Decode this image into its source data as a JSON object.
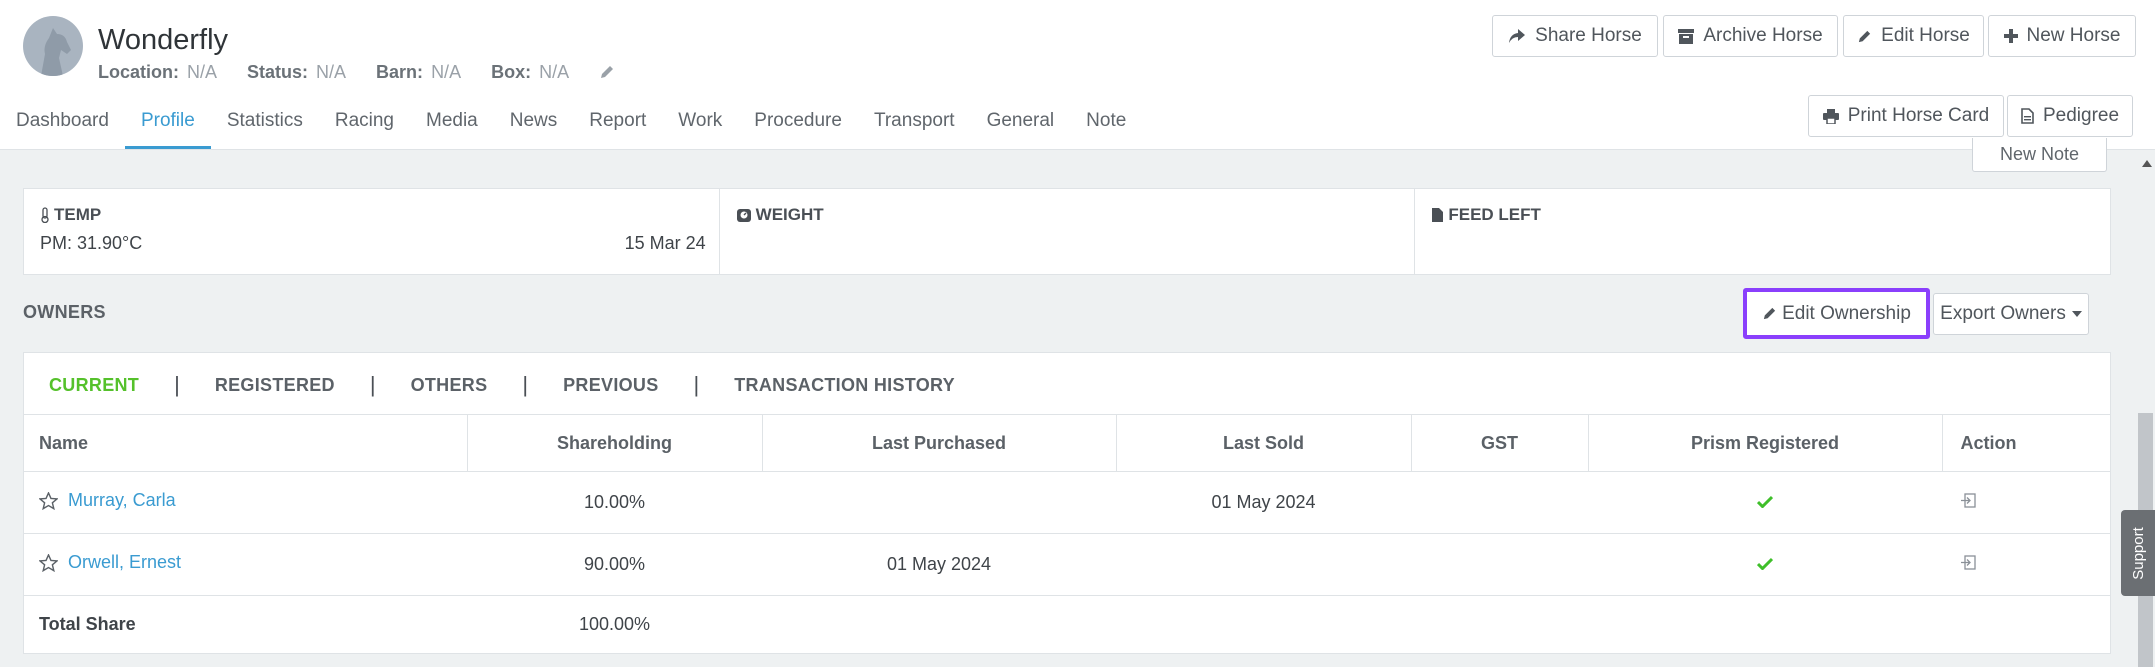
{
  "horse": {
    "name": "Wonderfly",
    "location_label": "Location:",
    "location_value": "N/A",
    "status_label": "Status:",
    "status_value": "N/A",
    "barn_label": "Barn:",
    "barn_value": "N/A",
    "box_label": "Box:",
    "box_value": "N/A"
  },
  "actions": {
    "share": "Share Horse",
    "archive": "Archive Horse",
    "edit": "Edit Horse",
    "new": "New Horse",
    "print": "Print Horse Card",
    "pedigree": "Pedigree"
  },
  "tabs": [
    "Dashboard",
    "Profile",
    "Statistics",
    "Racing",
    "Media",
    "News",
    "Report",
    "Work",
    "Procedure",
    "Transport",
    "General",
    "Note"
  ],
  "active_tab": "Profile",
  "new_note": "New Note",
  "stats": {
    "temp_label": "TEMP",
    "temp_value": "PM: 31.90°C",
    "temp_date": "15 Mar 24",
    "weight_label": "WEIGHT",
    "feed_label": "FEED LEFT"
  },
  "owners": {
    "title": "OWNERS",
    "edit_button": "Edit Ownership",
    "export_button": "Export Owners",
    "subtabs": [
      "CURRENT",
      "REGISTERED",
      "OTHERS",
      "PREVIOUS",
      "TRANSACTION HISTORY"
    ],
    "sep": "|",
    "columns": [
      "Name",
      "Shareholding",
      "Last Purchased",
      "Last Sold",
      "GST",
      "Prism Registered",
      "Action"
    ],
    "rows": [
      {
        "name": "Murray, Carla",
        "shareholding": "10.00%",
        "last_purchased": "",
        "last_sold": "01 May 2024",
        "gst": ""
      },
      {
        "name": "Orwell, Ernest",
        "shareholding": "90.00%",
        "last_purchased": "01 May 2024",
        "last_sold": "",
        "gst": ""
      }
    ],
    "total_label": "Total Share",
    "total_value": "100.00%"
  },
  "support_label": "Support",
  "colors": {
    "accent": "#3a9bd1",
    "active_green": "#55c12b",
    "highlight": "#8a3ffc",
    "check": "#3fbf2a"
  }
}
